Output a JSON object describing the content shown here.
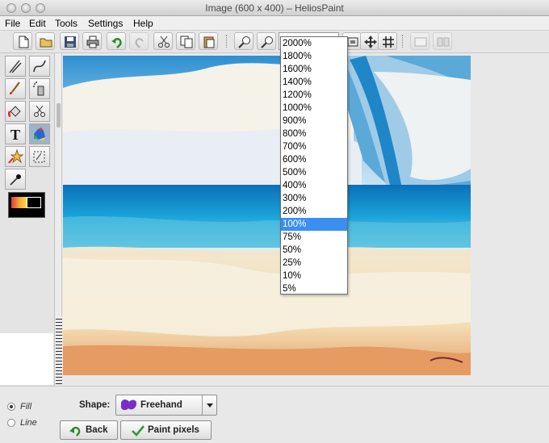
{
  "window": {
    "title": "Image (600 x 400) – HeliosPaint"
  },
  "menubar": {
    "items": [
      "File",
      "Edit",
      "Tools",
      "Settings",
      "Help"
    ]
  },
  "toolbar": {
    "zoom_value": "",
    "zoom_options": [
      "2000%",
      "1800%",
      "1600%",
      "1400%",
      "1200%",
      "1000%",
      "900%",
      "800%",
      "700%",
      "600%",
      "500%",
      "400%",
      "300%",
      "200%",
      "100%",
      "75%",
      "50%",
      "25%",
      "10%",
      "5%"
    ],
    "zoom_selected": "100%"
  },
  "tools": {
    "foreground_color": "#e03a3a",
    "background_color": "#000000",
    "selected_tool": "color-fill"
  },
  "bottom": {
    "fill_label": "Fill",
    "line_label": "Line",
    "selected_mode": "Fill",
    "shape_label": "Shape:",
    "shape_value": "Freehand",
    "back_label": "Back",
    "paint_label": "Paint pixels"
  },
  "colors": {
    "selection": "#3a8ef0",
    "shape_swatch": "#7a2ec9",
    "confirm_check": "#2f9a2f"
  }
}
